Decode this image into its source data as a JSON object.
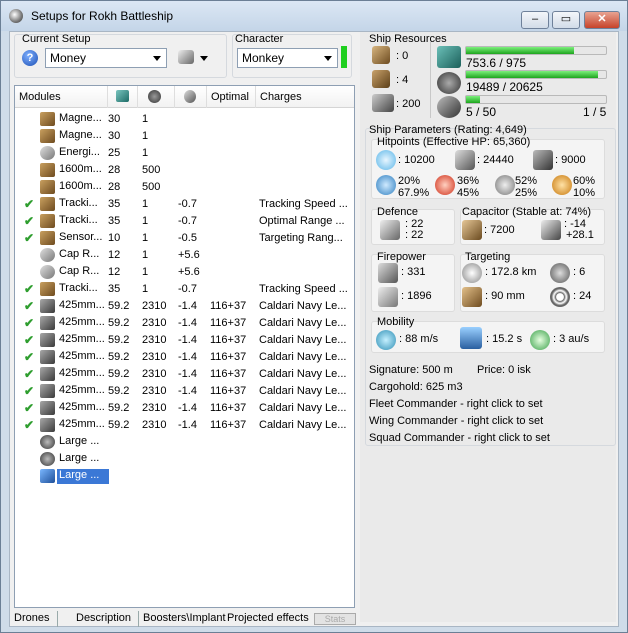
{
  "window": {
    "title": "Setups for Rokh Battleship"
  },
  "setup": {
    "label": "Current Setup",
    "value": "Money"
  },
  "character": {
    "label": "Character",
    "value": "Monkey"
  },
  "modules": {
    "headers": [
      "Modules",
      "",
      "",
      "",
      "Optimal",
      "Charges"
    ],
    "rows": [
      {
        "check": false,
        "name": "Magne...",
        "c1": "30",
        "c2": "1",
        "c3": "",
        "optimal": "",
        "charges": "",
        "icon": "mod"
      },
      {
        "check": false,
        "name": "Magne...",
        "c1": "30",
        "c2": "1",
        "c3": "",
        "optimal": "",
        "charges": "",
        "icon": "mod"
      },
      {
        "check": false,
        "name": "Energi...",
        "c1": "25",
        "c2": "1",
        "c3": "",
        "optimal": "",
        "charges": "",
        "icon": "cap"
      },
      {
        "check": false,
        "name": "1600m...",
        "c1": "28",
        "c2": "500",
        "c3": "",
        "optimal": "",
        "charges": "",
        "icon": "mod"
      },
      {
        "check": false,
        "name": "1600m...",
        "c1": "28",
        "c2": "500",
        "c3": "",
        "optimal": "",
        "charges": "",
        "icon": "mod"
      },
      {
        "check": true,
        "name": "Tracki...",
        "c1": "35",
        "c2": "1",
        "c3": "-0.7",
        "optimal": "",
        "charges": "Tracking Speed ...",
        "icon": "mod"
      },
      {
        "check": true,
        "name": "Tracki...",
        "c1": "35",
        "c2": "1",
        "c3": "-0.7",
        "optimal": "",
        "charges": "Optimal Range ...",
        "icon": "mod"
      },
      {
        "check": true,
        "name": "Sensor...",
        "c1": "10",
        "c2": "1",
        "c3": "-0.5",
        "optimal": "",
        "charges": "Targeting Rang...",
        "icon": "mod"
      },
      {
        "check": false,
        "name": "Cap R...",
        "c1": "12",
        "c2": "1",
        "c3": "+5.6",
        "optimal": "",
        "charges": "",
        "icon": "cap"
      },
      {
        "check": false,
        "name": "Cap R...",
        "c1": "12",
        "c2": "1",
        "c3": "+5.6",
        "optimal": "",
        "charges": "",
        "icon": "cap"
      },
      {
        "check": true,
        "name": "Tracki...",
        "c1": "35",
        "c2": "1",
        "c3": "-0.7",
        "optimal": "",
        "charges": "Tracking Speed ...",
        "icon": "mod"
      },
      {
        "check": true,
        "name": "425mm...",
        "c1": "59.2",
        "c2": "2310",
        "c3": "-1.4",
        "optimal": "116+37",
        "charges": "Caldari Navy Le...",
        "icon": "gun"
      },
      {
        "check": true,
        "name": "425mm...",
        "c1": "59.2",
        "c2": "2310",
        "c3": "-1.4",
        "optimal": "116+37",
        "charges": "Caldari Navy Le...",
        "icon": "gun"
      },
      {
        "check": true,
        "name": "425mm...",
        "c1": "59.2",
        "c2": "2310",
        "c3": "-1.4",
        "optimal": "116+37",
        "charges": "Caldari Navy Le...",
        "icon": "gun"
      },
      {
        "check": true,
        "name": "425mm...",
        "c1": "59.2",
        "c2": "2310",
        "c3": "-1.4",
        "optimal": "116+37",
        "charges": "Caldari Navy Le...",
        "icon": "gun"
      },
      {
        "check": true,
        "name": "425mm...",
        "c1": "59.2",
        "c2": "2310",
        "c3": "-1.4",
        "optimal": "116+37",
        "charges": "Caldari Navy Le...",
        "icon": "gun"
      },
      {
        "check": true,
        "name": "425mm...",
        "c1": "59.2",
        "c2": "2310",
        "c3": "-1.4",
        "optimal": "116+37",
        "charges": "Caldari Navy Le...",
        "icon": "gun"
      },
      {
        "check": true,
        "name": "425mm...",
        "c1": "59.2",
        "c2": "2310",
        "c3": "-1.4",
        "optimal": "116+37",
        "charges": "Caldari Navy Le...",
        "icon": "gun"
      },
      {
        "check": true,
        "name": "425mm...",
        "c1": "59.2",
        "c2": "2310",
        "c3": "-1.4",
        "optimal": "116+37",
        "charges": "Caldari Navy Le...",
        "icon": "gun"
      },
      {
        "check": false,
        "name": "Large ...",
        "c1": "",
        "c2": "",
        "c3": "",
        "optimal": "",
        "charges": "",
        "icon": "drn"
      },
      {
        "check": false,
        "name": "Large ...",
        "c1": "",
        "c2": "",
        "c3": "",
        "optimal": "",
        "charges": "",
        "icon": "drn"
      },
      {
        "check": false,
        "name": "Large ...",
        "c1": "",
        "c2": "",
        "c3": "",
        "optimal": "",
        "charges": "",
        "icon": "sel",
        "selected": true
      }
    ]
  },
  "tabs": [
    "Drones",
    "Description",
    "Boosters\\Implant",
    "Projected effects",
    "Stats"
  ],
  "resources": {
    "label": "Ship Resources",
    "turret_slots": ": 0",
    "launcher_slots": ": 4",
    "calibration": ": 200",
    "cpu": "753.6 / 975",
    "cpu_fraction": 0.77,
    "powergrid": "19489 / 20625",
    "powergrid_fraction": 0.945,
    "drone_bay": "5 / 50",
    "drone_bay_fraction": 0.1,
    "drones_active": "1 / 5"
  },
  "params": {
    "label": "Ship Parameters (Rating: 4,649)",
    "hitpoints_label": "Hitpoints (Effective HP: 65,360)",
    "shield_hp": ": 10200",
    "armor_hp": ": 24440",
    "structure_hp": ": 9000",
    "res1_a": "20%",
    "res1_b": "67.9%",
    "res2_a": "36%",
    "res2_b": "45%",
    "res3_a": "52%",
    "res3_b": "25%",
    "res4_a": "60%",
    "res4_b": "10%",
    "defence_label": "Defence",
    "defence_a": ": 22",
    "defence_b": ": 22",
    "capacitor_label": "Capacitor (Stable at: 74%)",
    "cap_amount": ": 7200",
    "cap_delta_a": ": -14",
    "cap_delta_b": "+28.1",
    "firepower_label": "Firepower",
    "fp_a": ": 331",
    "fp_b": ": 1896",
    "targeting_label": "Targeting",
    "t_range": ": 172.8 km",
    "t_targets": ": 6",
    "t_res": ": 90 mm",
    "t_sens": ": 24",
    "mobility_label": "Mobility",
    "m_speed": ": 88 m/s",
    "m_align": ": 15.2 s",
    "m_warp": ": 3 au/s"
  },
  "info": {
    "signature": "Signature: 500 m",
    "price": "Price: 0 isk",
    "cargohold": "Cargohold: 625 m3",
    "fleet": "Fleet Commander - right click to set",
    "wing": "Wing Commander - right click to set",
    "squad": "Squad Commander - right click to set"
  }
}
